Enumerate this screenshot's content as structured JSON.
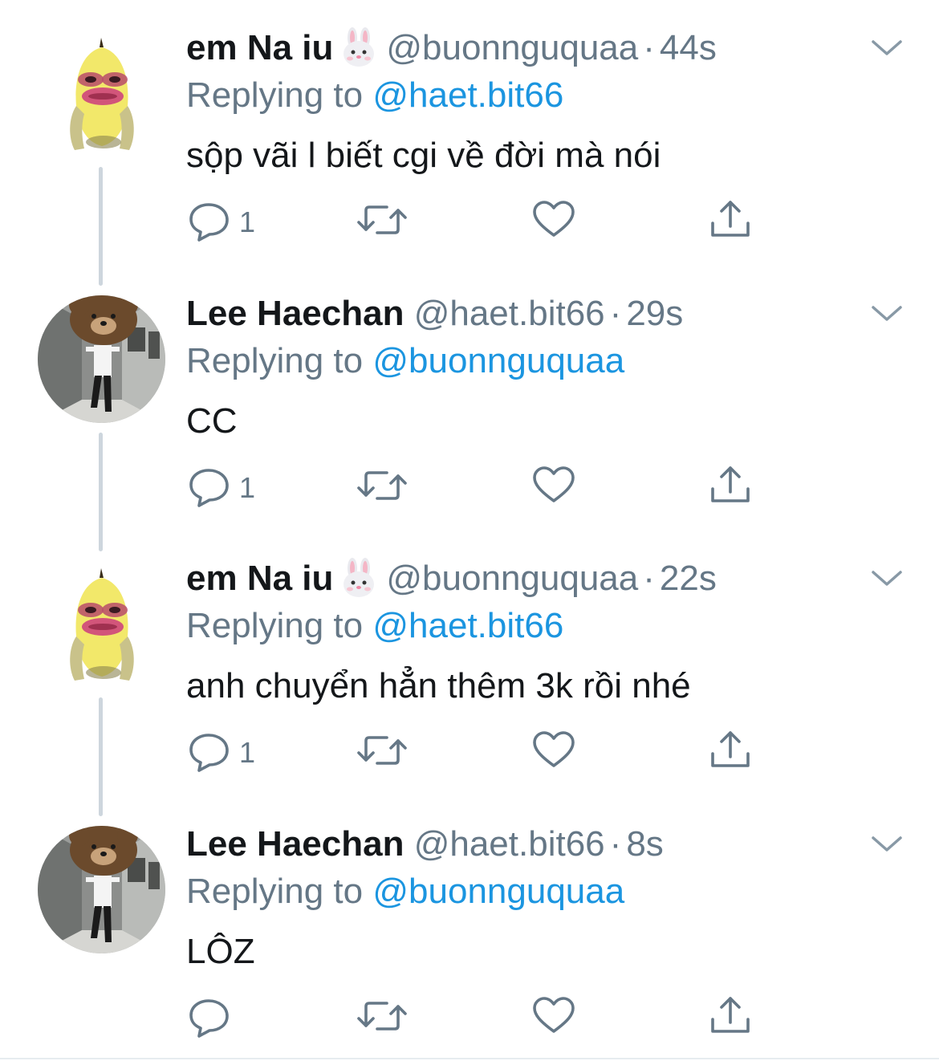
{
  "tweets": [
    {
      "name": "em Na iu",
      "name_emoji": "rabbit-face",
      "handle": "@buonnguquaa",
      "separator": "·",
      "time": "44s",
      "reply_prefix": "Replying to",
      "reply_to": "@haet.bit66",
      "text": "sộp vãi l biết cgi về đời mà nói",
      "reply_count": "1",
      "avatar": "banana-avatar"
    },
    {
      "name": "Lee Haechan",
      "handle": "@haet.bit66",
      "separator": "·",
      "time": "29s",
      "reply_prefix": "Replying to",
      "reply_to": "@buonnguquaa",
      "text": "CC",
      "reply_count": "1",
      "avatar": "bear-photo-avatar"
    },
    {
      "name": "em Na iu",
      "name_emoji": "rabbit-face",
      "handle": "@buonnguquaa",
      "separator": "·",
      "time": "22s",
      "reply_prefix": "Replying to",
      "reply_to": "@haet.bit66",
      "text": "anh chuyển hẳn thêm 3k rồi nhé",
      "reply_count": "1",
      "avatar": "banana-avatar"
    },
    {
      "name": "Lee Haechan",
      "handle": "@haet.bit66",
      "separator": "·",
      "time": "8s",
      "reply_prefix": "Replying to",
      "reply_to": "@buonnguquaa",
      "text": "LÔZ",
      "reply_count": "",
      "avatar": "bear-photo-avatar"
    }
  ],
  "colors": {
    "primary_text": "#14171a",
    "secondary_text": "#657786",
    "mention": "#1b95e0",
    "thread_line": "#cdd6dd"
  },
  "icons": {
    "menu": "chevron-down-icon",
    "reply": "comment-bubble-icon",
    "retweet": "retweet-icon",
    "like": "heart-icon",
    "share": "share-upload-icon"
  }
}
